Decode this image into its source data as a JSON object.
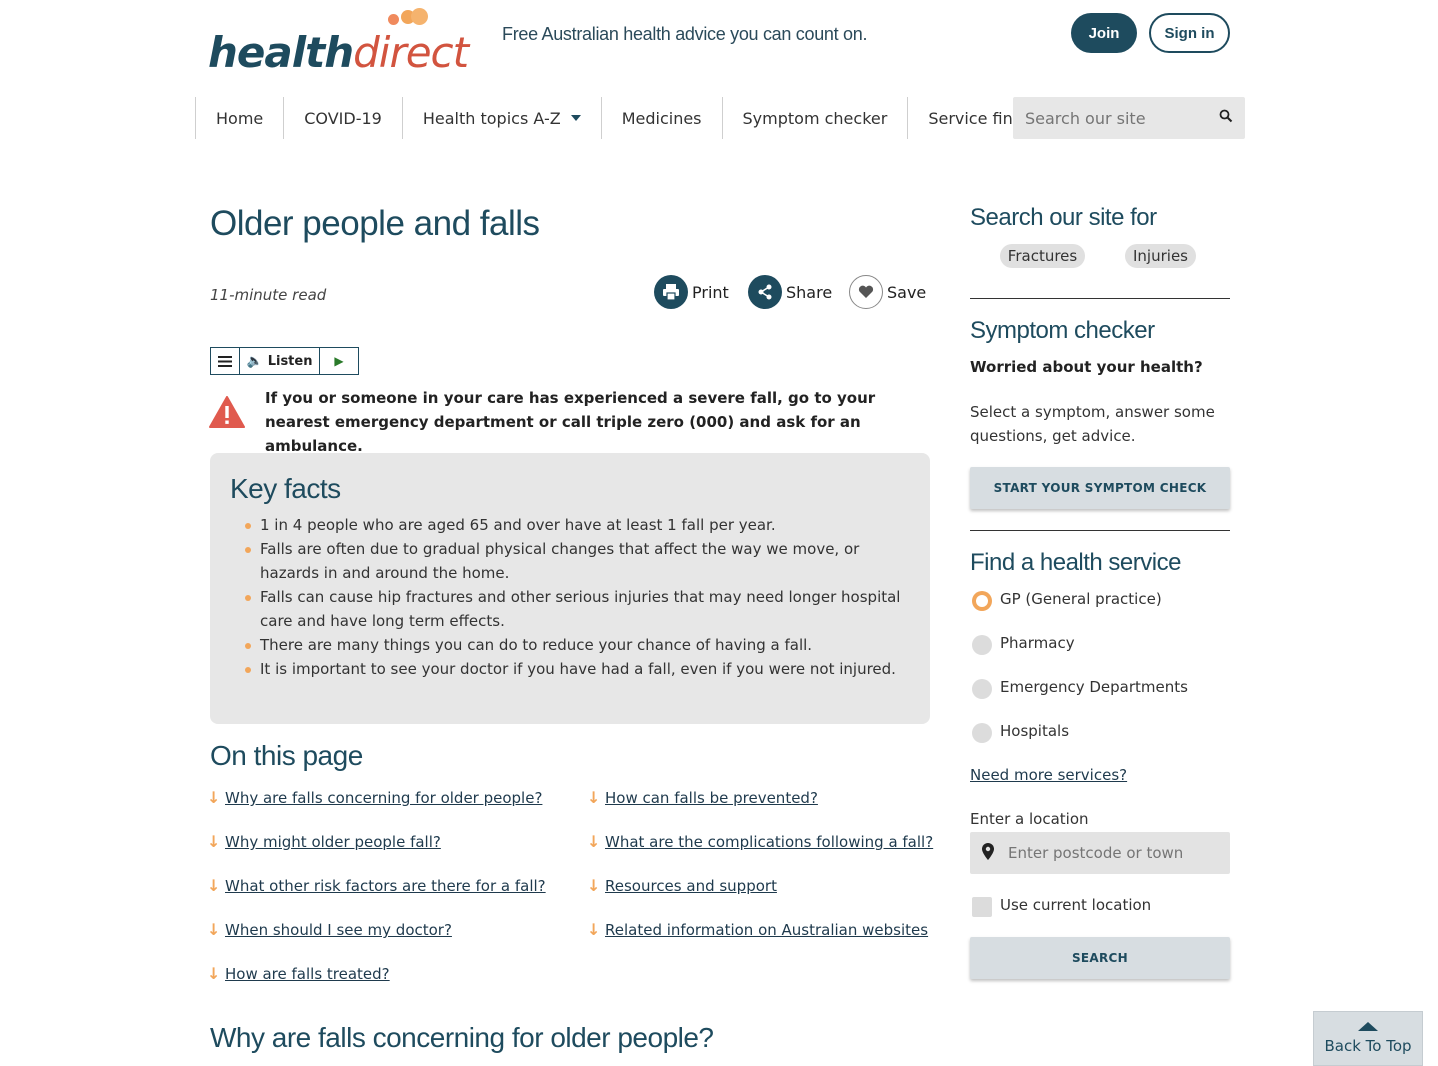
{
  "header": {
    "logo_part1": "health",
    "logo_part2": "direct",
    "tagline": "Free Australian health advice you can count on.",
    "join_label": "Join",
    "signin_label": "Sign in",
    "brand_colors": {
      "primary": "#1e4b5e",
      "accent": "#d2543f",
      "orange": "#f2a65a"
    }
  },
  "nav": {
    "items": [
      "Home",
      "COVID-19",
      "Health topics A-Z",
      "Medicines",
      "Symptom checker",
      "Service finder"
    ],
    "search_placeholder": "Search our site"
  },
  "article": {
    "title": "Older people and falls",
    "read_time": "11-minute read",
    "actions": {
      "print": "Print",
      "share": "Share",
      "save": "Save"
    },
    "listen_label": "Listen",
    "warning": "If you or someone in your care has experienced a severe fall, go to your nearest emergency department or call triple zero (000) and ask for an ambulance.",
    "key_facts": {
      "title": "Key facts",
      "items": [
        "1 in 4 people who are aged 65 and over have at least 1 fall per year.",
        "Falls are often due to gradual physical changes that affect the way we move, or hazards in and around the home.",
        "Falls can cause hip fractures and other serious injuries that may need longer hospital care and have long term effects.",
        "There are many things you can do to reduce your chance of having a fall.",
        "It is important to see your doctor if you have had a fall, even if you were not injured."
      ]
    },
    "on_this_page": {
      "title": "On this page",
      "left": [
        "Why are falls concerning for older people?",
        "Why might older people fall?",
        "What other risk factors are there for a fall?",
        "When should I see my doctor?",
        "How are falls treated?"
      ],
      "right": [
        "How can falls be prevented?",
        "What are the complications following a fall?",
        "Resources and support",
        "Related information on Australian websites"
      ]
    },
    "section_title": "Why are falls concerning for older people?"
  },
  "sidebar": {
    "search_title": "Search our site for",
    "pills": [
      "Fractures",
      "Injuries"
    ],
    "symptom_title": "Symptom checker",
    "symptom_question": "Worried about your health?",
    "symptom_text": "Select a symptom, answer some questions, get advice.",
    "symptom_button": "START YOUR SYMPTOM CHECK",
    "service_title": "Find a health service",
    "services": [
      "GP (General practice)",
      "Pharmacy",
      "Emergency Departments",
      "Hospitals"
    ],
    "selected_service": "GP (General practice)",
    "more_services": "Need more services?",
    "location_label": "Enter a location",
    "location_placeholder": "Enter postcode or town",
    "current_location": "Use current location",
    "search_button": "SEARCH"
  },
  "back_to_top": "Back To Top"
}
